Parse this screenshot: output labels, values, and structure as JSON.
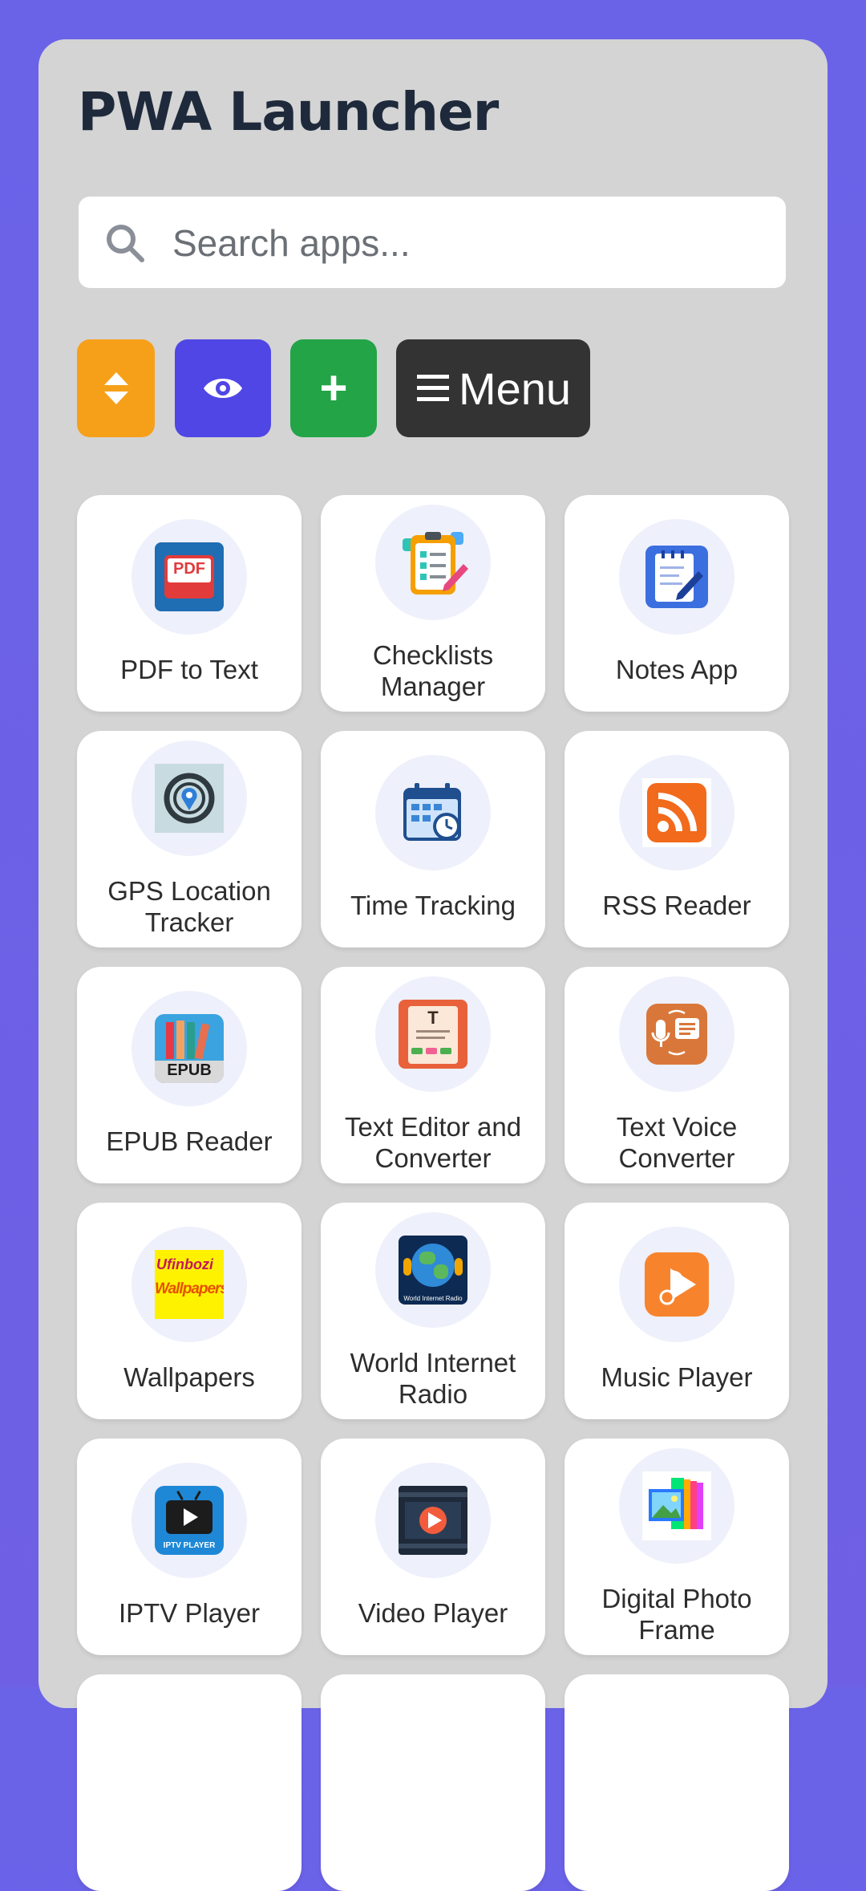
{
  "header": {
    "title": "PWA Launcher"
  },
  "search": {
    "placeholder": "Search apps..."
  },
  "toolbar": {
    "menu_label": "Menu",
    "add_symbol": "+"
  },
  "apps": [
    {
      "name": "PDF to Text"
    },
    {
      "name": "Checklists Manager"
    },
    {
      "name": "Notes App"
    },
    {
      "name": "GPS Location Tracker"
    },
    {
      "name": "Time Tracking"
    },
    {
      "name": "RSS Reader"
    },
    {
      "name": "EPUB Reader"
    },
    {
      "name": "Text Editor and Converter"
    },
    {
      "name": "Text Voice Converter"
    },
    {
      "name": "Wallpapers"
    },
    {
      "name": "World Internet Radio"
    },
    {
      "name": "Music Player"
    },
    {
      "name": "IPTV Player"
    },
    {
      "name": "Video Player"
    },
    {
      "name": "Digital Photo Frame"
    }
  ],
  "icon_text": {
    "pdf": "PDF",
    "epub": "EPUB",
    "text_editor": "T",
    "iptv": "IPTV PLAYER",
    "wallpapers_line1": "Ufinbozi",
    "wallpapers_line2": "Wallpapers",
    "radio": "World Internet Radio"
  },
  "colors": {
    "background": "#6a63e8",
    "panel": "#d4d4d4",
    "sort_button": "#f6a01a",
    "visibility_button": "#4f46e5",
    "add_button": "#22a447",
    "menu_button": "#333333"
  }
}
